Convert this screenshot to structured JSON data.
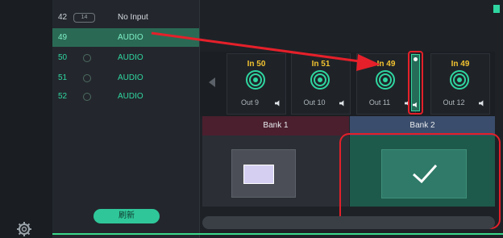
{
  "inputs": [
    {
      "num": "42",
      "badge": "14",
      "type": "No Input",
      "state": "normal"
    },
    {
      "num": "49",
      "badge": "",
      "type": "AUDIO",
      "state": "selected"
    },
    {
      "num": "50",
      "badge": "",
      "type": "AUDIO",
      "state": "dim"
    },
    {
      "num": "51",
      "badge": "",
      "type": "AUDIO",
      "state": "dim"
    },
    {
      "num": "52",
      "badge": "",
      "type": "AUDIO",
      "state": "dim"
    }
  ],
  "refresh_label": "刷新",
  "outputs": [
    {
      "in": "In 50",
      "out": "Out 9"
    },
    {
      "in": "In 51",
      "out": "Out 10"
    },
    {
      "in": "In 49",
      "out": "Out 11"
    },
    {
      "in": "In 49",
      "out": "Out 12"
    }
  ],
  "banks": [
    {
      "label": "Bank 1"
    },
    {
      "label": "Bank 2"
    }
  ],
  "icons": {
    "settings": "gear-icon",
    "previous": "chevron-left-icon",
    "target": "target-icon",
    "speaker": "speaker-icon",
    "check": "check-icon"
  },
  "colors": {
    "accent": "#2fd6a0",
    "input_label": "#f2c230",
    "annotation": "#e5202a",
    "bank1": "#4b1f2e",
    "bank2": "#3b4d6c"
  }
}
